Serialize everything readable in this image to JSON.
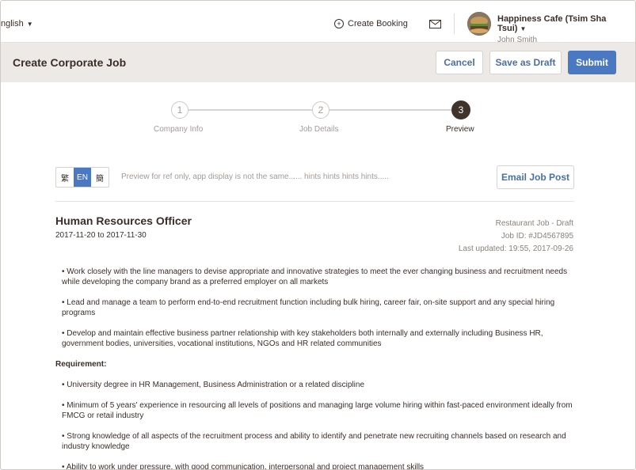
{
  "topbar": {
    "language": "nglish",
    "create_booking": "Create Booking",
    "cafe_name": "Happiness Cafe (Tsim Sha Tsui)",
    "user_name": "John Smith"
  },
  "header": {
    "title": "Create Corporate Job",
    "cancel": "Cancel",
    "save_draft": "Save as Draft",
    "submit": "Submit"
  },
  "steps": [
    {
      "num": "1",
      "label": "Company Info",
      "state": "inactive"
    },
    {
      "num": "2",
      "label": "Job Details",
      "state": "inactive"
    },
    {
      "num": "3",
      "label": "Preview",
      "state": "active"
    }
  ],
  "preview": {
    "lang_options": [
      "繁",
      "EN",
      "簡"
    ],
    "lang_selected": "EN",
    "hint": "Preview for ref only, app display is not the same...... hints hints hints hints.....",
    "email_button": "Email Job Post"
  },
  "job": {
    "title": "Human Resources Officer",
    "dates": "2017-11-20 to 2017-11-30",
    "type": "Restaurant Job - Draft",
    "job_id": "Job ID: #JD4567895",
    "updated": "Last updated: 19:55, 2017-09-26",
    "duties": [
      "• Work closely with the line managers to devise appropriate and innovative strategies to meet the ever changing business and recruitment needs while developing the company brand as a preferred employer on all markets",
      "• Lead and manage a team to perform end-to-end recruitment function including bulk hiring, career fair, on-site support and any special hiring programs",
      "• Develop and maintain effective business partner relationship with key stakeholders both internally and externally including Business HR, government bodies, universities, vocational institutions, NGOs and HR related communities"
    ],
    "requirement_heading": "Requirement:",
    "requirements": [
      "• University degree in HR Management, Business Administration or a related discipline",
      "• Minimum of 5 years' experience in resourcing all levels of positions and managing large volume hiring within fast-paced environment ideally from FMCG or retail industry",
      "• Strong knowledge of all aspects of the recruitment process and ability to identify and penetrate new recruiting channels based on research and industry knowledge",
      "• Ability to work under pressure, with good communication, interpersonal and project management skills"
    ]
  },
  "colors": {
    "accent": "#4a78c2",
    "header_bg": "#ece9e6",
    "text": "#3a2e28",
    "muted": "#a39b95"
  }
}
